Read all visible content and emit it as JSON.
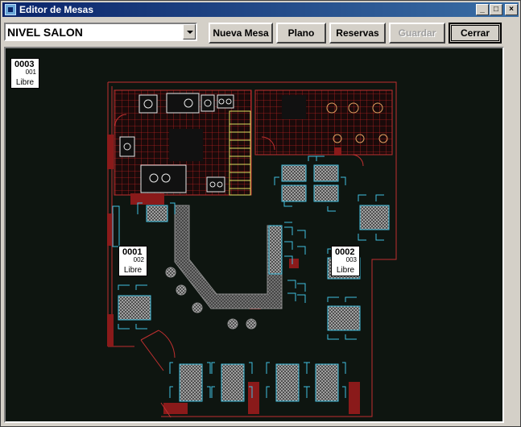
{
  "window": {
    "title": "Editor de Mesas"
  },
  "titlebar_buttons": [
    {
      "name": "minimize-button",
      "glyph": "_"
    },
    {
      "name": "maximize-button",
      "glyph": "□"
    },
    {
      "name": "close-button",
      "glyph": "×"
    }
  ],
  "toolbar": {
    "level_select": "NIVEL SALON",
    "nueva_mesa": "Nueva Mesa",
    "plano": "Plano",
    "reservas": "Reservas",
    "guardar": "Guardar",
    "cerrar": "Cerrar"
  },
  "tables": [
    {
      "id": "0003",
      "sub": "001",
      "status": "Libre"
    },
    {
      "id": "0001",
      "sub": "002",
      "status": "Libre"
    },
    {
      "id": "0002",
      "sub": "003",
      "status": "Libre"
    }
  ],
  "floorplan": {
    "colors": {
      "background": "#0e1510",
      "walls": "#c03030",
      "grid": "#b02020",
      "furniture": "#40c0e0",
      "stairs": "#e0e060",
      "counter": "#808080",
      "door": "#8a1a1a"
    }
  }
}
